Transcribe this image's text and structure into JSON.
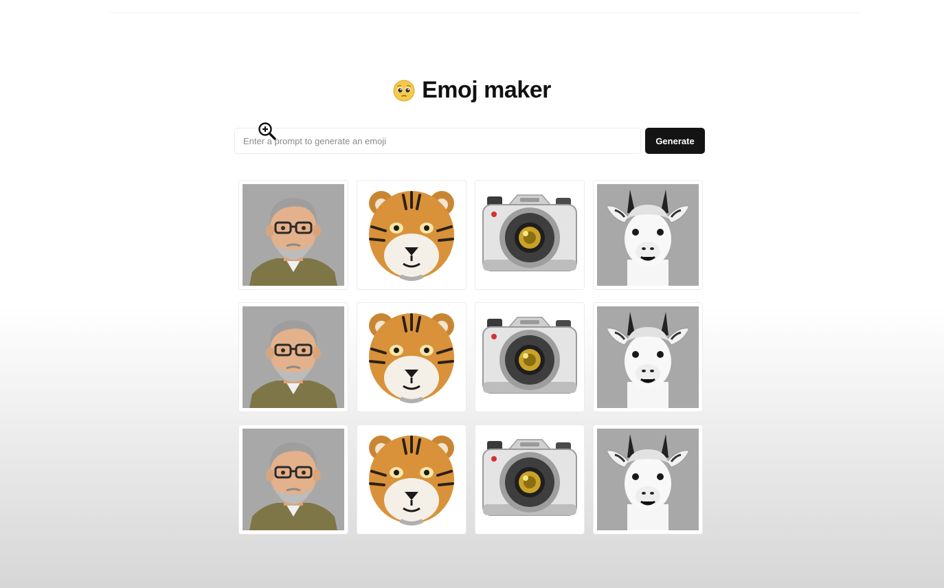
{
  "header": {
    "title": "Emoj maker",
    "title_icon": "pleading-face-emoji"
  },
  "prompt": {
    "placeholder": "Enter a prompt to generate an emoji",
    "value": ""
  },
  "generate_button": {
    "label": "Generate",
    "color": "#141414"
  },
  "cursor": {
    "icon": "zoom-in-cursor"
  },
  "emoji_grid": {
    "rows": [
      [
        "man-with-glasses",
        "tiger-face",
        "camera",
        "llama"
      ],
      [
        "man-with-glasses",
        "tiger-face",
        "camera",
        "llama"
      ],
      [
        "man-with-glasses",
        "tiger-face",
        "camera",
        "llama"
      ]
    ]
  },
  "colors": {
    "tile_gray": "#a8a8a8",
    "tiger_orange": "#d9923a",
    "camera_lens_gold": "#c9a227"
  }
}
